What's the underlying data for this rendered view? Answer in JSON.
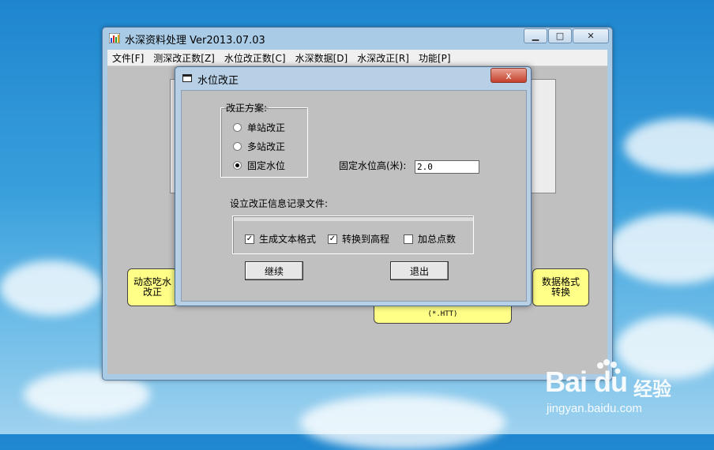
{
  "main_window": {
    "title": "水深资料处理 Ver2013.07.03",
    "menu": [
      "文件[F]",
      "测深改正数[Z]",
      "水位改正数[C]",
      "水深数据[D]",
      "水深改正[R]",
      "功能[P]"
    ],
    "buttons": {
      "dynamic_draft": "动态吃水\n改正",
      "data_format": "数据格式\n转换",
      "hidden_bottom": "(*.HTT)"
    }
  },
  "dialog": {
    "title": "水位改正",
    "close_label": "x",
    "scheme_group_label": "改正方案:",
    "options": [
      {
        "label": "单站改正",
        "selected": false
      },
      {
        "label": "多站改正",
        "selected": false
      },
      {
        "label": "固定水位",
        "selected": true
      }
    ],
    "fixed_level_label": "固定水位高(米):",
    "fixed_level_value": "2.0",
    "log_file_label": "设立改正信息记录文件:",
    "checkboxes": [
      {
        "label": "生成文本格式",
        "checked": true
      },
      {
        "label": "转换到高程",
        "checked": true
      },
      {
        "label": "加总点数",
        "checked": false
      }
    ],
    "continue_label": "继续",
    "exit_label": "退出"
  },
  "watermark": {
    "brand": "Bai du",
    "cn": "经验",
    "url": "jingyan.baidu.com"
  }
}
